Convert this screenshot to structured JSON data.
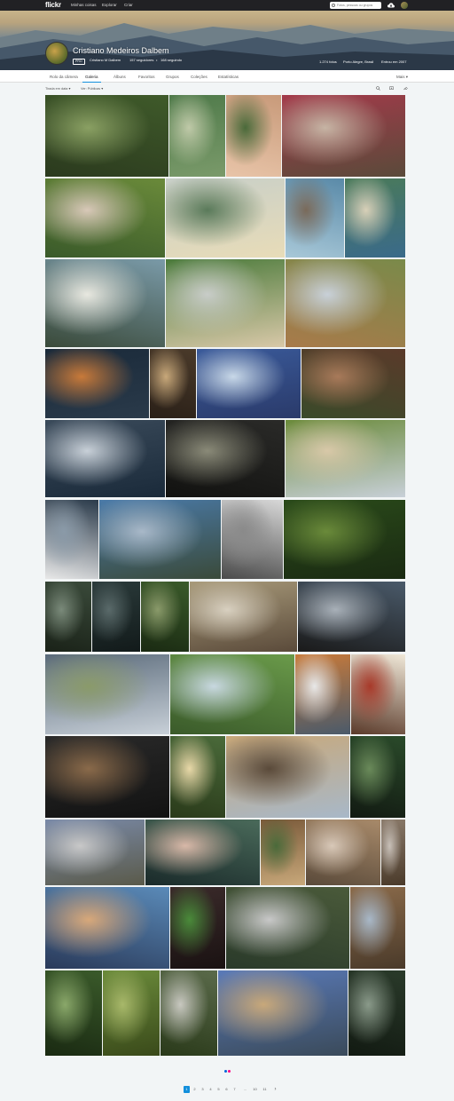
{
  "topnav": {
    "logo": "flickr",
    "links": [
      "Minhas coisas",
      "Explorar",
      "Criar"
    ],
    "search_placeholder": "Fotos, pessoas ou grupos"
  },
  "profile": {
    "name": "Cristiano Medeiros Dalbem",
    "pro_badge": "PRO",
    "username": "Cristiano M Dalbem",
    "followers": "157 seguidores",
    "following": "168 seguindo",
    "photos_count": "1.274 fotos",
    "location": "Porto Alegre, Brasil",
    "joined": "Entrou em 2007"
  },
  "tabs": [
    {
      "label": "Rolo da câmera",
      "active": false
    },
    {
      "label": "Galeria",
      "active": true
    },
    {
      "label": "Álbuns",
      "active": false
    },
    {
      "label": "Favoritos",
      "active": false
    },
    {
      "label": "Grupos",
      "active": false
    },
    {
      "label": "Coleções",
      "active": false
    },
    {
      "label": "Estatísticas",
      "active": false
    }
  ],
  "more_label": "Mais",
  "filters": {
    "sort": "Tirada em data",
    "visibility": "Ver: Públicas"
  },
  "toolbar_icons": [
    "search-icon",
    "slideshow-icon",
    "share-icon"
  ],
  "photos": [
    {
      "name": "photo-forest-hammock",
      "colors": [
        "#3f5a2a",
        "#8aa063",
        "#2b3a1e"
      ]
    },
    {
      "name": "photo-river-bend",
      "colors": [
        "#4f7a4a",
        "#bfc9a8",
        "#7a9a6a"
      ]
    },
    {
      "name": "photo-woman-tree",
      "colors": [
        "#c89a7a",
        "#4a6a3a",
        "#e8c4a8"
      ]
    },
    {
      "name": "photo-woman-scarf",
      "colors": [
        "#a33a4a",
        "#c6b4a4",
        "#5a4a3a"
      ]
    },
    {
      "name": "photo-friends-grass",
      "colors": [
        "#6a8a3a",
        "#d8c8b8",
        "#3a5a2a"
      ]
    },
    {
      "name": "photo-beach-hazy",
      "colors": [
        "#c8cfc8",
        "#5a7a5a",
        "#e8dcb8"
      ]
    },
    {
      "name": "photo-rocky-coast",
      "colors": [
        "#5a8aa8",
        "#7a6a5a",
        "#a8c8d8"
      ]
    },
    {
      "name": "photo-beach-cove",
      "colors": [
        "#4a7a5a",
        "#d8d0b8",
        "#3a6a8a"
      ]
    },
    {
      "name": "photo-beach-rocks",
      "colors": [
        "#7a9aa8",
        "#e8e8e0",
        "#3a4a3a"
      ]
    },
    {
      "name": "photo-green-hill",
      "colors": [
        "#4a7a3a",
        "#c8ccc8",
        "#d8c8a8"
      ]
    },
    {
      "name": "photo-coastal-trail",
      "colors": [
        "#7a8a4a",
        "#c8d0d8",
        "#a87a4a"
      ]
    },
    {
      "name": "photo-window-sunset",
      "colors": [
        "#1a2a3a",
        "#c87a3a",
        "#2a3a4a"
      ]
    },
    {
      "name": "photo-room-interior",
      "colors": [
        "#4a3a2a",
        "#c8a87a",
        "#2a2018"
      ]
    },
    {
      "name": "photo-sky-building",
      "colors": [
        "#3a5a9a",
        "#c8d8e8",
        "#2a3a6a"
      ]
    },
    {
      "name": "photo-redwood-trunk",
      "colors": [
        "#5a3a2a",
        "#a87a5a",
        "#3a4a2a"
      ]
    },
    {
      "name": "photo-snowy-mountains",
      "colors": [
        "#3a4a5a",
        "#c8d0d8",
        "#1a2a3a"
      ]
    },
    {
      "name": "photo-stormy-sky",
      "colors": [
        "#2a2a28",
        "#8a8a78",
        "#121210"
      ]
    },
    {
      "name": "photo-standing-stones",
      "colors": [
        "#6a8a3a",
        "#d8c8a8",
        "#c8d0d8"
      ]
    },
    {
      "name": "photo-seal-rocks",
      "colors": [
        "#2a3a4a",
        "#8a9aa8",
        "#e8e8e8"
      ]
    },
    {
      "name": "photo-bay-panorama",
      "colors": [
        "#4a7aa8",
        "#a8b8c8",
        "#3a4a3a"
      ]
    },
    {
      "name": "photo-snow-tree",
      "colors": [
        "#d8d8d8",
        "#8a8a8a",
        "#4a4a4a"
      ]
    },
    {
      "name": "photo-mossy-forest",
      "colors": [
        "#2a4a1a",
        "#6a8a3a",
        "#1a2a12"
      ]
    },
    {
      "name": "photo-dark-trail",
      "colors": [
        "#3a4a3a",
        "#7a8a7a",
        "#1a2218"
      ]
    },
    {
      "name": "photo-pine-road",
      "colors": [
        "#2a3a3a",
        "#5a6a6a",
        "#121a1a"
      ]
    },
    {
      "name": "photo-tree-tunnel",
      "colors": [
        "#3a5a2a",
        "#8a9a6a",
        "#1a2a12"
      ]
    },
    {
      "name": "photo-sheep-field",
      "colors": [
        "#a89a7a",
        "#d8d0c0",
        "#5a4a3a"
      ]
    },
    {
      "name": "photo-dark-sea",
      "colors": [
        "#4a5a6a",
        "#a8b0b8",
        "#1a1a1a"
      ]
    },
    {
      "name": "photo-misty-valley",
      "colors": [
        "#5a6a7a",
        "#8a9a6a",
        "#c8d0d8"
      ]
    },
    {
      "name": "photo-golf-field",
      "colors": [
        "#6a9a4a",
        "#c8d8e0",
        "#3a5a2a"
      ]
    },
    {
      "name": "photo-autumn-peaks",
      "colors": [
        "#c87a3a",
        "#e8e8e8",
        "#4a5a6a"
      ]
    },
    {
      "name": "photo-dessert-plate",
      "colors": [
        "#f0e8d8",
        "#a83a2a",
        "#5a3a2a"
      ]
    },
    {
      "name": "photo-couple-bench",
      "colors": [
        "#2a2a2a",
        "#8a6a4a",
        "#121212"
      ]
    },
    {
      "name": "photo-forest-sunlight",
      "colors": [
        "#4a6a3a",
        "#e8d8a8",
        "#2a3a1a"
      ]
    },
    {
      "name": "photo-cliff-portrait",
      "colors": [
        "#c8a87a",
        "#5a4a3a",
        "#a8b8c8"
      ]
    },
    {
      "name": "photo-fern-path",
      "colors": [
        "#2a4a2a",
        "#6a8a5a",
        "#121a12"
      ]
    },
    {
      "name": "photo-rainbow-terrace",
      "colors": [
        "#7a8aa8",
        "#c8c8c8",
        "#5a5a4a"
      ]
    },
    {
      "name": "photo-glasses-closeup",
      "colors": [
        "#4a6a5a",
        "#d8b8a8",
        "#1a2a2a"
      ]
    },
    {
      "name": "photo-totem-pole",
      "colors": [
        "#7a5a3a",
        "#4a6a3a",
        "#c8a87a"
      ]
    },
    {
      "name": "photo-old-building",
      "colors": [
        "#a88a6a",
        "#d8c8b8",
        "#5a4a3a"
      ]
    },
    {
      "name": "photo-street-houses",
      "colors": [
        "#8a7a6a",
        "#c8c0b8",
        "#4a3a2a"
      ]
    },
    {
      "name": "photo-dunes-sunset",
      "colors": [
        "#5a8ab8",
        "#d8a87a",
        "#2a3a5a"
      ]
    },
    {
      "name": "photo-green-leaf",
      "colors": [
        "#3a2a2a",
        "#4a8a3a",
        "#1a1212"
      ]
    },
    {
      "name": "photo-campfire-smoke",
      "colors": [
        "#4a5a3a",
        "#c8c8c8",
        "#2a3a2a"
      ]
    },
    {
      "name": "photo-heart-stone",
      "colors": [
        "#8a6a4a",
        "#a8b8c8",
        "#4a3a2a"
      ]
    },
    {
      "name": "photo-jungle-river",
      "colors": [
        "#3a5a2a",
        "#8aa86a",
        "#1a2a12"
      ]
    },
    {
      "name": "photo-forest-clearing",
      "colors": [
        "#6a8a3a",
        "#a8b86a",
        "#3a4a1a"
      ]
    },
    {
      "name": "photo-campfire-men",
      "colors": [
        "#5a6a4a",
        "#c8c8c0",
        "#2a3a1a"
      ]
    },
    {
      "name": "photo-tent-man",
      "colors": [
        "#5a7ab8",
        "#c8a87a",
        "#3a4a5a"
      ]
    },
    {
      "name": "photo-waterfall",
      "colors": [
        "#2a3a2a",
        "#8a9a8a",
        "#121a12"
      ]
    }
  ],
  "pager": {
    "pages": [
      "1",
      "2",
      "3",
      "4",
      "5",
      "6",
      "7",
      "…",
      "10",
      "11"
    ],
    "current": "1",
    "next": "›"
  },
  "colors": {
    "accent": "#128fdc",
    "topbar": "#212124",
    "dot_blue": "#0063dc",
    "dot_pink": "#ff0084"
  }
}
